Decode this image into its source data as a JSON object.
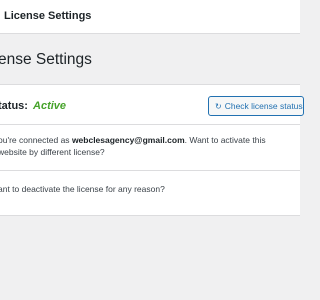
{
  "topbar": {
    "title": "License Settings"
  },
  "page": {
    "heading": "ense Settings"
  },
  "status": {
    "label": "tatus:",
    "value": "Active",
    "value_color": "#46a32a",
    "check_button": {
      "icon": "refresh-icon",
      "label": "Check license status"
    }
  },
  "connection": {
    "prefix": "ou're connected as",
    "email": "webclesagency@gmail.com",
    "suffix": ". Want to activate this website by",
    "link_text": "different license?"
  },
  "deactivate": {
    "text": "ant to deactivate the license for any reason?"
  }
}
